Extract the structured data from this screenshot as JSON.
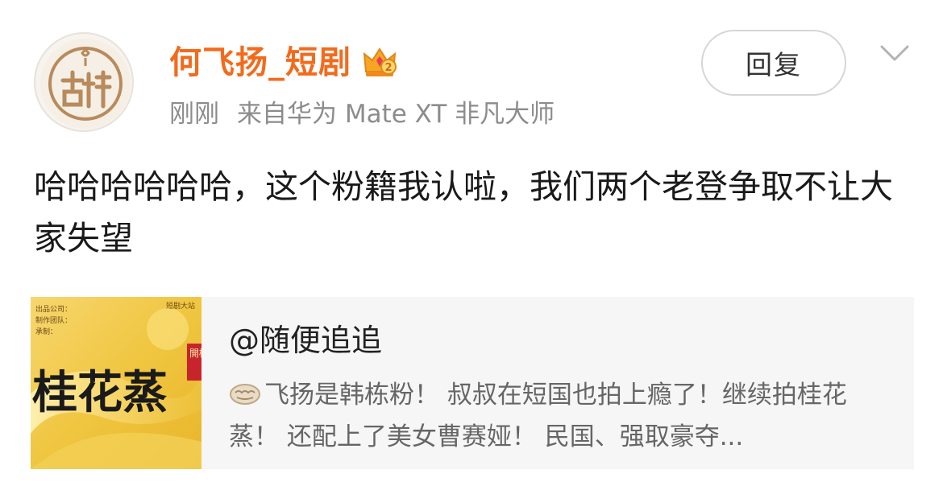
{
  "post": {
    "author": {
      "name": "何飞扬_短剧",
      "avatar_text": "吉祥",
      "badge_icon": "crown-icon",
      "badge_level": "2"
    },
    "meta": {
      "time": "刚刚",
      "source": "来自华为 Mate XT 非凡大师"
    },
    "reply_button_label": "回复",
    "dropdown_icon": "chevron-down-icon",
    "text": "哈哈哈哈哈哈，这个粉籍我认啦，我们两个老登争取不让大家失望",
    "shared_card": {
      "title": "@随便追追",
      "text": "飞扬是韩栋粉！ 叔叔在短国也拍上瘾了！继续拍桂花蒸！ 还配上了美女曹赛娅！ 民国、强取豪夺...",
      "emoji_icon": "dumpling-emoji-icon",
      "poster": {
        "title": "桂花蒸",
        "corner_text": "開機大吉",
        "credits": [
          "出品公司：",
          "制作团队：",
          "承制："
        ],
        "top_right": "短剧大站"
      }
    }
  },
  "colors": {
    "username": "#f26b1d",
    "meta": "#8c8c8c",
    "card_bg": "#f6f6f6",
    "poster_gold": "#f0c640"
  }
}
